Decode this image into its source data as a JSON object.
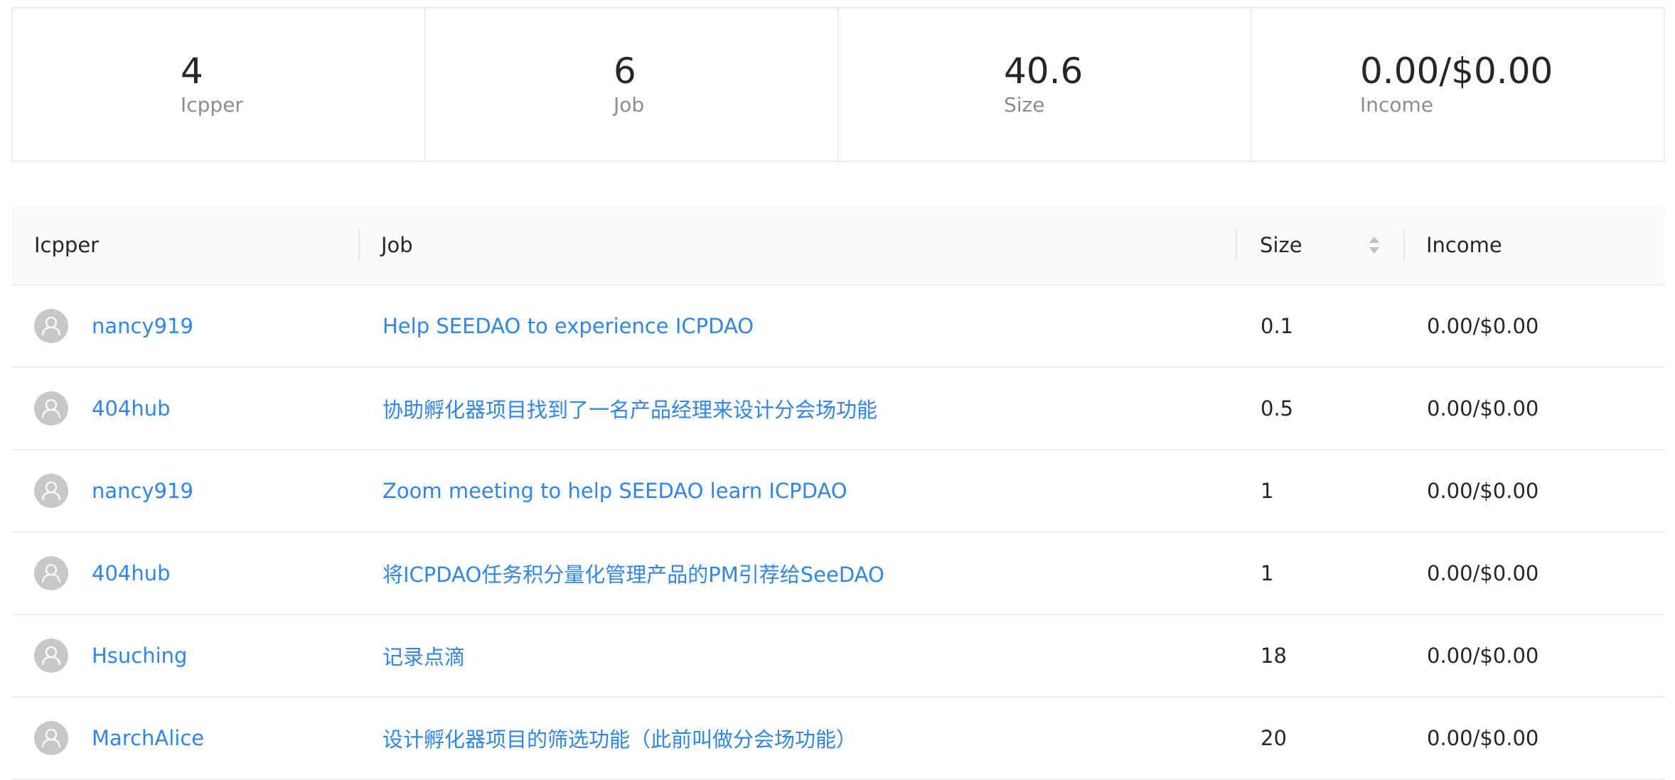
{
  "stats": [
    {
      "value": "4",
      "label": "Icpper"
    },
    {
      "value": "6",
      "label": "Job"
    },
    {
      "value": "40.6",
      "label": "Size"
    },
    {
      "value": "0.00/$0.00",
      "label": "Income"
    }
  ],
  "table": {
    "columns": {
      "icpper": "Icpper",
      "job": "Job",
      "size": "Size",
      "income": "Income"
    },
    "rows": [
      {
        "icpper": "nancy919",
        "job": "Help SEEDAO to experience ICPDAO",
        "size": "0.1",
        "income": "0.00/$0.00"
      },
      {
        "icpper": "404hub",
        "job": "协助孵化器项目找到了一名产品经理来设计分会场功能",
        "size": "0.5",
        "income": "0.00/$0.00"
      },
      {
        "icpper": "nancy919",
        "job": "Zoom meeting to help SEEDAO learn ICPDAO",
        "size": "1",
        "income": "0.00/$0.00"
      },
      {
        "icpper": "404hub",
        "job": "将ICPDAO任务积分量化管理产品的PM引荐给SeeDAO",
        "size": "1",
        "income": "0.00/$0.00"
      },
      {
        "icpper": "Hsuching",
        "job": "记录点滴",
        "size": "18",
        "income": "0.00/$0.00"
      },
      {
        "icpper": "MarchAlice",
        "job": "设计孵化器项目的筛选功能（此前叫做分会场功能）",
        "size": "20",
        "income": "0.00/$0.00"
      }
    ]
  },
  "colors": {
    "link": "#2f86e8",
    "avatar_bg": "#c8c8c8",
    "header_bg": "#fafafa"
  },
  "icons": {
    "avatar": "user-icon",
    "sort": "sort-icon"
  }
}
